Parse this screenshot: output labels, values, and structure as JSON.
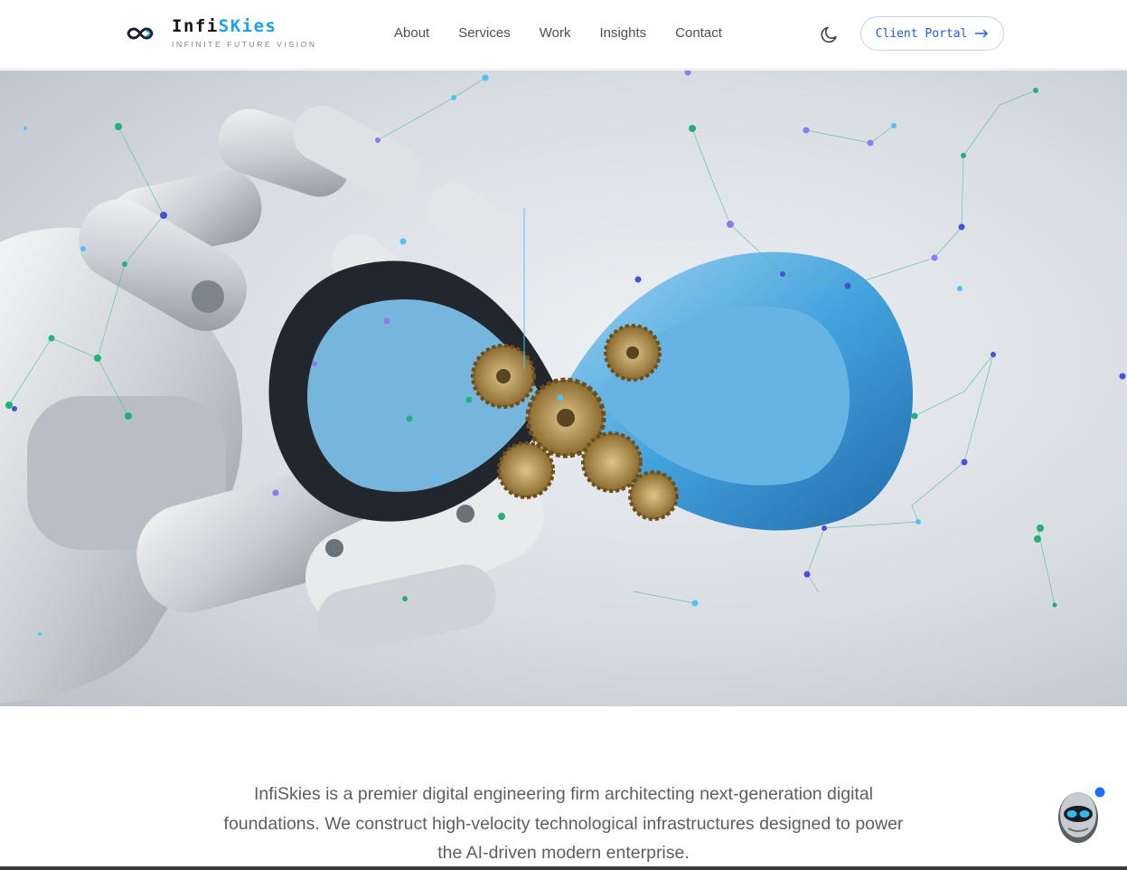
{
  "brand": {
    "name_part1": "Infi",
    "name_part2": "SKies",
    "tagline": "INFINITE FUTURE VISION",
    "icon": "infinity-logo-icon",
    "accent_color": "#1aa3e8"
  },
  "nav": {
    "items": [
      {
        "label": "About"
      },
      {
        "label": "Services"
      },
      {
        "label": "Work"
      },
      {
        "label": "Insights"
      },
      {
        "label": "Contact"
      }
    ]
  },
  "header_actions": {
    "theme_toggle_icon": "moon-icon",
    "portal_label": "Client Portal",
    "portal_icon": "arrow-right-icon",
    "portal_color": "#1b5fd6"
  },
  "hero": {
    "image": "robotic-hand-holding-infinity-symbol-with-gears",
    "accent_color": "#2b8fd8"
  },
  "intro": {
    "text": "InfiSkies is a premier digital engineering firm architecting next-generation digital foundations. We construct high-velocity technological infrastructures designed to power the AI-driven modern enterprise."
  },
  "chat": {
    "icon": "robot-assistant-icon",
    "badge_color": "#1f6fff"
  }
}
